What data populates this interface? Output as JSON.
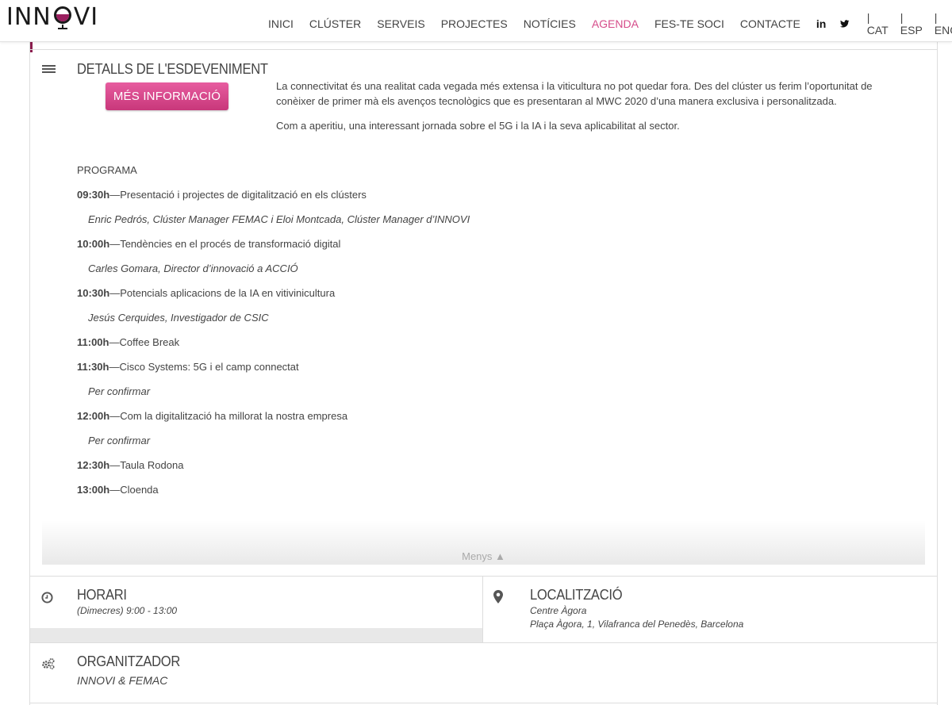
{
  "header": {
    "logo_text": "INNOVI",
    "nav": [
      {
        "label": "INICI",
        "active": false
      },
      {
        "label": "CLÚSTER",
        "active": false
      },
      {
        "label": "SERVEIS",
        "active": false
      },
      {
        "label": "PROJECTES",
        "active": false
      },
      {
        "label": "NOTÍCIES",
        "active": false
      },
      {
        "label": "AGENDA",
        "active": true
      },
      {
        "label": "FES-TE SOCI",
        "active": false
      },
      {
        "label": "CONTACTE",
        "active": false
      }
    ],
    "linkedin": "in",
    "languages": [
      "| CAT",
      "| ESP",
      "| ENG"
    ],
    "accent_color": "#d64c8a"
  },
  "details": {
    "title": "DETALLS DE L'ESDEVENIMENT",
    "button": "MÉS INFORMACIÓ",
    "paragraphs": [
      "La connectivitat és una realitat cada vegada més extensa i la viticultura no pot quedar fora. Des del clúster us ferim l’oportunitat de conèixer de primer mà els avenços tecnològics que es presentaran al MWC 2020 d’una manera exclusiva i personalitzada.",
      "Com a aperitiu, una interessant jornada sobre el 5G i la IA i la seva aplicabilitat al sector."
    ],
    "program_title": "PROGRAMA",
    "program": [
      {
        "time": "09:30h",
        "title": "—Presentació i projectes de digitalització en els clústers",
        "speaker": "Enric Pedrós, Clúster Manager FEMAC i Eloi Montcada, Clúster Manager d’INNOVI"
      },
      {
        "time": "10:00h",
        "title": "—Tendències en el procés de transformació digital",
        "speaker": "Carles Gomara, Director d’innovació a ACCIÓ"
      },
      {
        "time": "10:30h",
        "title": "—Potencials aplicacions de la IA en vitivinicultura",
        "speaker": "Jesús Cerquides, Investigador de CSIC"
      },
      {
        "time": "11:00h",
        "title": "—Coffee Break",
        "speaker": ""
      },
      {
        "time": "11:30h",
        "title": "—Cisco Systems: 5G i el camp connectat",
        "speaker": "Per confirmar"
      },
      {
        "time": "12:00h",
        "title": "—Com la digitalització ha millorat la nostra empresa",
        "speaker": "Per confirmar"
      },
      {
        "time": "12:30h",
        "title": "—Taula Rodona",
        "speaker": ""
      },
      {
        "time": "13:00h",
        "title": "—Cloenda",
        "speaker": ""
      }
    ],
    "less_label": "Menys ▲"
  },
  "horari": {
    "title": "HORARI",
    "value": "(Dimecres) 9:00 - 13:00"
  },
  "localitzacio": {
    "title": "LOCALITZACIÓ",
    "place": "Centre Àgora",
    "address": "Plaça Àgora, 1, Vilafranca del Penedès, Barcelona"
  },
  "organitzador": {
    "title": "ORGANITZADOR",
    "value": "INNOVI & FEMAC"
  }
}
